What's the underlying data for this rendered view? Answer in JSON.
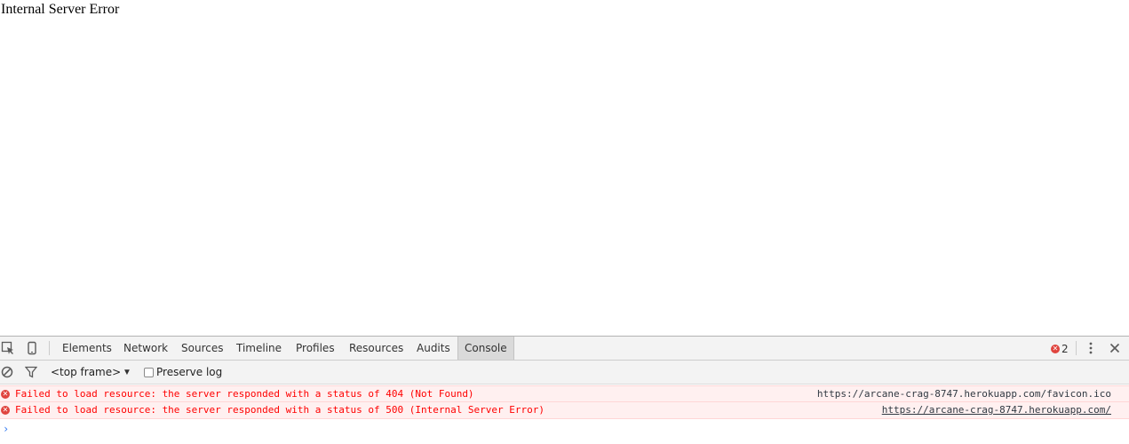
{
  "page": {
    "error_text": "Internal Server Error"
  },
  "devtools": {
    "tabs": [
      {
        "label": "Elements"
      },
      {
        "label": "Network"
      },
      {
        "label": "Sources"
      },
      {
        "label": "Timeline"
      },
      {
        "label": "Profiles"
      },
      {
        "label": "Resources"
      },
      {
        "label": "Audits"
      },
      {
        "label": "Console",
        "active": true
      }
    ],
    "error_count": "2",
    "icons": {
      "inspect": "inspect-element-icon",
      "device": "device-mode-icon",
      "menu": "more-vertical-icon",
      "close": "close-icon",
      "clear": "clear-console-icon",
      "filter": "filter-icon"
    },
    "filterbar": {
      "frame": "<top frame>",
      "frame_arrow": "▼",
      "preserve_log": "Preserve log"
    },
    "messages": [
      {
        "text": "Failed to load resource: the server responded with a status of 404 (Not Found)",
        "source": "https://arcane-crag-8747.herokuapp.com/favicon.ico"
      },
      {
        "text": "Failed to load resource: the server responded with a status of 500 (Internal Server Error)",
        "source": "https://arcane-crag-8747.herokuapp.com/"
      }
    ],
    "prompt_symbol": "›",
    "colors": {
      "error": "#ff0000",
      "error_bg": "#fff0f0",
      "error_badge": "#e0443e",
      "prompt": "#367cf1"
    }
  }
}
